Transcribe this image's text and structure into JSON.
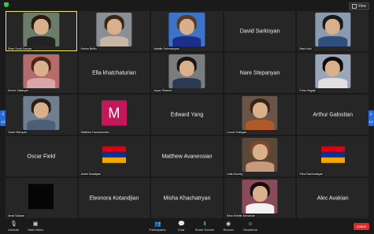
{
  "topbar": {
    "view_label": "View"
  },
  "pager": {
    "left_label": "1/2",
    "right_label": "1/2"
  },
  "tiles": [
    {
      "name": "Shari Scott-Sawyer",
      "kind": "photo",
      "active": true,
      "bg": "#6b7d6a",
      "hair": "#2a1a12",
      "shirt": "#222222"
    },
    {
      "name": "Kesha Bellin",
      "kind": "photo",
      "bg": "#8a8f96",
      "hair": "#3a2418",
      "shirt": "#c9b7a6"
    },
    {
      "name": "Natalie Sahmaroyan",
      "kind": "photo",
      "bg": "#3b74c8",
      "hair": "#5a3a20",
      "shirt": "#1b2f8a"
    },
    {
      "name": "David Sarkisyan",
      "kind": "name"
    },
    {
      "name": "Mark Aziz",
      "kind": "photo",
      "bg": "#8a9bb0",
      "hair": "#1a1a1a",
      "shirt": "#2e4f7a"
    },
    {
      "name": "Kenne Zakaryan",
      "kind": "photo",
      "bg": "#b36b6b",
      "hair": "#4a2416",
      "shirt": "#d8a6a6"
    },
    {
      "name": "Ella khatchaturian",
      "kind": "name"
    },
    {
      "name": "Aryan Sharma",
      "kind": "photo",
      "bg": "#7a7d7f",
      "hair": "#1f1410",
      "shirt": "#2a3a55"
    },
    {
      "name": "Nare Stepanyan",
      "kind": "name"
    },
    {
      "name": "Erina Vegaja",
      "kind": "photo",
      "bg": "#9aa7b8",
      "hair": "#120c0a",
      "shirt": "#e0e0e0"
    },
    {
      "name": "Gavin Marquez",
      "kind": "photo",
      "bg": "#6d7f91",
      "hair": "#2c1e14",
      "shirt": "#4c5f77"
    },
    {
      "name": "Matthew Harootoonian",
      "kind": "avatar",
      "letter": "M"
    },
    {
      "name": "Edward Yang",
      "kind": "name"
    },
    {
      "name": "Leona Orlanyan",
      "kind": "photo",
      "bg": "#6a5448",
      "hair": "#3a2214",
      "shirt": "#b05a2a"
    },
    {
      "name": "Arthur Galostian",
      "kind": "name"
    },
    {
      "name": "Oscar Field",
      "kind": "name"
    },
    {
      "name": "Andre Badalyan",
      "kind": "flag-photo"
    },
    {
      "name": "Matthew Avanessian",
      "kind": "name"
    },
    {
      "name": "Lelia Buchey",
      "kind": "photo",
      "bg": "#5a4738",
      "hair": "#7a4a2a",
      "shirt": "#c99a7a"
    },
    {
      "name": "Elina Bazhmakyan",
      "kind": "flag"
    },
    {
      "name": "Amal Sabaar",
      "kind": "black"
    },
    {
      "name": "Eleonora Kotandjian",
      "kind": "name"
    },
    {
      "name": "Misha Khachatryan",
      "kind": "name"
    },
    {
      "name": "Mina Estelle Alexanian",
      "kind": "photo",
      "bg": "#8a4a5a",
      "hair": "#150e0c",
      "shirt": "#f2f2f2"
    },
    {
      "name": "Alec Avakian",
      "kind": "name"
    }
  ],
  "toolbar": {
    "unmute": "Unmute",
    "start_video": "Start Video",
    "participants": "Participants",
    "chat": "Chat",
    "share_screen": "Share Screen",
    "record": "Record",
    "reactions": "Reactions",
    "leave": "Leave",
    "participants_count": "25"
  }
}
